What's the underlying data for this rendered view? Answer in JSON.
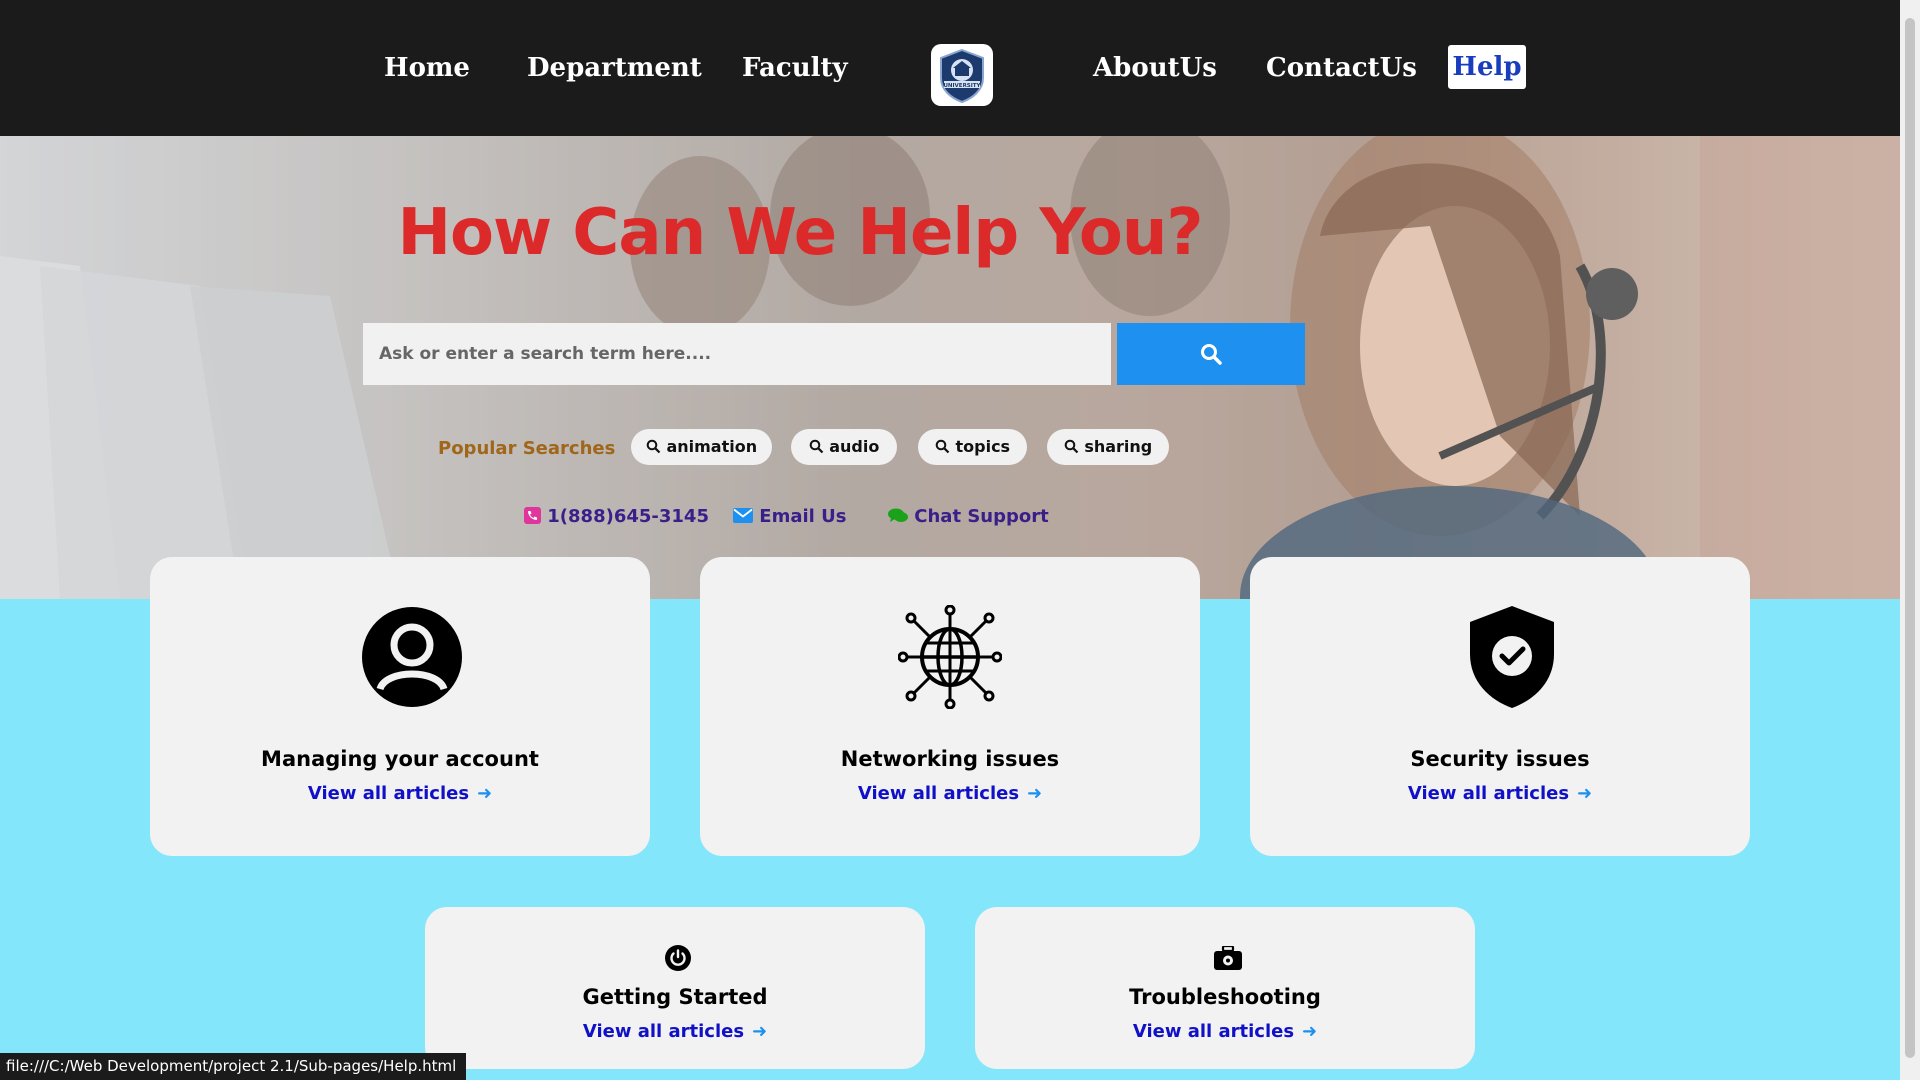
{
  "nav": {
    "home": "Home",
    "department": "Department",
    "faculty": "Faculty",
    "logo_text": "UNIVERSITY",
    "about": "AboutUs",
    "contact": "ContactUs",
    "help": "Help"
  },
  "hero": {
    "title": "How Can We Help You?",
    "search_placeholder": "Ask or enter a search term here....",
    "popular_label": "Popular Searches",
    "chips": [
      "animation",
      "audio",
      "topics",
      "sharing"
    ],
    "phone": "1(888)645-3145",
    "email": "Email Us",
    "chat": "Chat Support"
  },
  "cards": [
    {
      "title": "Managing your account",
      "link": "View all articles",
      "icon": "user-circle-icon"
    },
    {
      "title": "Networking issues",
      "link": "View all articles",
      "icon": "globe-network-icon"
    },
    {
      "title": "Security issues",
      "link": "View all articles",
      "icon": "shield-check-icon"
    },
    {
      "title": "Getting Started",
      "link": "View all articles",
      "icon": "power-icon"
    },
    {
      "title": "Troubleshooting",
      "link": "View all articles",
      "icon": "toolbox-icon"
    }
  ],
  "status_bar": {
    "url": "file:///C:/Web Development/project 2.1/Sub-pages/Help.html"
  },
  "colors": {
    "nav_bg": "#1b1b1b",
    "page_bg": "#84e6fb",
    "title_red": "#dc2a2a",
    "search_blue": "#1e90ef",
    "link_blue": "#1010c8"
  }
}
